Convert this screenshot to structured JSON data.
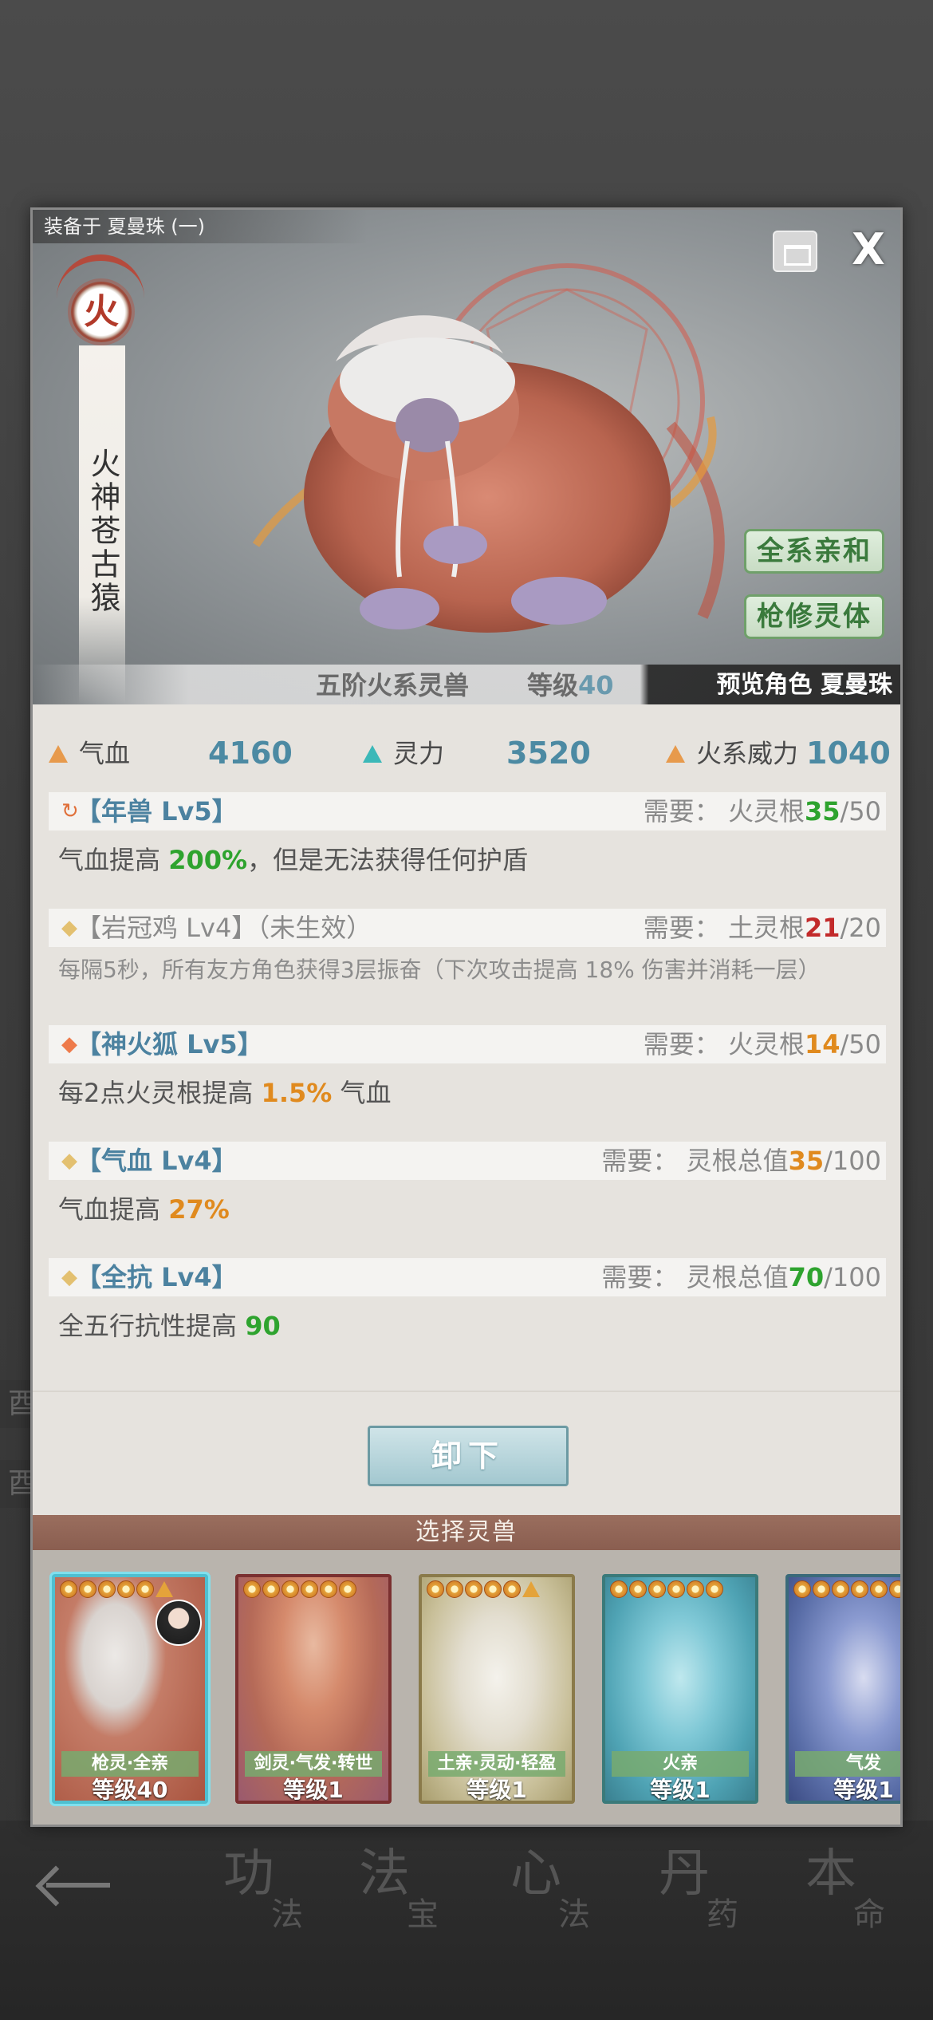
{
  "background": {
    "nav": [
      {
        "big": "功",
        "small": "法"
      },
      {
        "big": "法",
        "small": "宝"
      },
      {
        "big": "心",
        "small": "法"
      },
      {
        "big": "丹",
        "small": "药"
      },
      {
        "big": "本",
        "small": "命"
      }
    ],
    "side_tabs": [
      "酉",
      "酉"
    ]
  },
  "modal": {
    "equip_label": "装备于 夏曼珠 (一)",
    "close_glyph": "X",
    "element_glyph": "火",
    "beast_name": "火神苍古猿",
    "tags": [
      "全系亲和",
      "枪修灵体"
    ],
    "rank_text": "五阶火系灵兽",
    "level_label": "等级",
    "level_value": "40",
    "preview_text": "预览角色 夏曼珠"
  },
  "stats": [
    {
      "label": "气血",
      "value": "4160",
      "color": "#e79a4c"
    },
    {
      "label": "灵力",
      "value": "3520",
      "color": "#3bb8b8"
    },
    {
      "label": "火系威力",
      "value": "1040",
      "color": "#e79a4c"
    }
  ],
  "skills": [
    {
      "icon": "↻",
      "name": "【年兽 Lv5】",
      "req_label": "需要：",
      "req_root": "火灵根",
      "req_have": "35",
      "req_total": "/50",
      "desc_pre": "气血提高 ",
      "desc_num": "200%",
      "desc_post": "，但是无法获得任何护盾"
    },
    {
      "icon": "◆",
      "name": "【岩冠鸡 Lv4】（未生效）",
      "req_label": "需要：",
      "req_root": "土灵根",
      "req_have": "21",
      "req_total": "/20",
      "desc": "每隔5秒，所有友方角色获得3层振奋（下次攻击提高 18% 伤害并消耗一层）"
    },
    {
      "icon": "◆",
      "name": "【神火狐 Lv5】",
      "req_label": "需要：",
      "req_root": "火灵根",
      "req_have": "14",
      "req_total": "/50",
      "desc_pre": "每2点火灵根提高 ",
      "desc_num": "1.5%",
      "desc_post": " 气血"
    },
    {
      "icon": "◆",
      "name": "【气血 Lv4】",
      "req_label": "需要：",
      "req_root": "灵根总值",
      "req_have": "35",
      "req_total": "/100",
      "desc_pre": "气血提高 ",
      "desc_num": "27%",
      "desc_post": ""
    },
    {
      "icon": "◆",
      "name": "【全抗 Lv4】",
      "req_label": "需要：",
      "req_root": "灵根总值",
      "req_have": "70",
      "req_total": "/100",
      "desc_pre": "全五行抗性提高 ",
      "desc_num": "90",
      "desc_post": ""
    }
  ],
  "unequip_label": "卸下",
  "select_title": "选择灵兽",
  "cards": [
    {
      "traits": "枪灵·全亲",
      "level": "等级40",
      "selected": true
    },
    {
      "traits": "剑灵·气发·转世",
      "level": "等级1"
    },
    {
      "traits": "土亲·灵动·轻盈",
      "level": "等级1"
    },
    {
      "traits": "火亲",
      "level": "等级1"
    },
    {
      "traits": "气发",
      "level": "等级1"
    }
  ],
  "colors": {
    "accent_blue": "#4c82a0",
    "tag_green": "#3a7a3c",
    "value_green": "#2ea32e",
    "value_orange": "#e08a1e",
    "value_red": "#c22a2a",
    "fire_red": "#b23a2a"
  }
}
